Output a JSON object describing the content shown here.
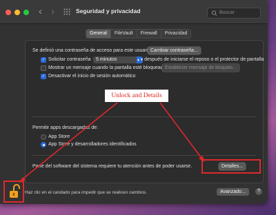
{
  "window": {
    "title": "Seguridad y privacidad",
    "back_glyph": "‹",
    "forward_glyph": "›",
    "search_placeholder": "Buscar"
  },
  "tabs": [
    {
      "label": "General",
      "active": true
    },
    {
      "label": "FileVault",
      "active": false
    },
    {
      "label": "Firewall",
      "active": false
    },
    {
      "label": "Privacidad",
      "active": false
    }
  ],
  "password": {
    "intro": "Se definió una contraseña de acceso para este usuario",
    "change_button": "Cambiar contraseña...",
    "require_label": "Solicitar contraseña",
    "require_checked": true,
    "require_value": "5 minutos",
    "require_suffix": "después de iniciarse el reposo o el protector de pantalla",
    "message_label": "Mostrar un mensaje cuando la pantalla esté bloqueada",
    "message_checked": false,
    "message_button": "Establecer mensaje de bloqueo...",
    "autologin_label": "Desactivar el inicio de sesión automático",
    "autologin_checked": true
  },
  "annotation": {
    "label": "Unlock and Details",
    "color": "#e0282b"
  },
  "downloads": {
    "heading": "Permitir apps descargadas de:",
    "options": [
      {
        "label": "App Store",
        "selected": false
      },
      {
        "label": "App Store y desarrolladores identificados",
        "selected": true
      }
    ]
  },
  "system_software": {
    "notice": "Parte del software del sistema requiere tu atención antes de poder usarse.",
    "details_button": "Detalles..."
  },
  "footer": {
    "lock_text": "Haz clic en el candado para impedir que se realicen cambios.",
    "advanced_button": "Avanzado...",
    "help_glyph": "?"
  },
  "colors": {
    "accent": "#2a6bd8",
    "annotation_red": "#e0282b",
    "lock_orange": "#f0a020"
  }
}
